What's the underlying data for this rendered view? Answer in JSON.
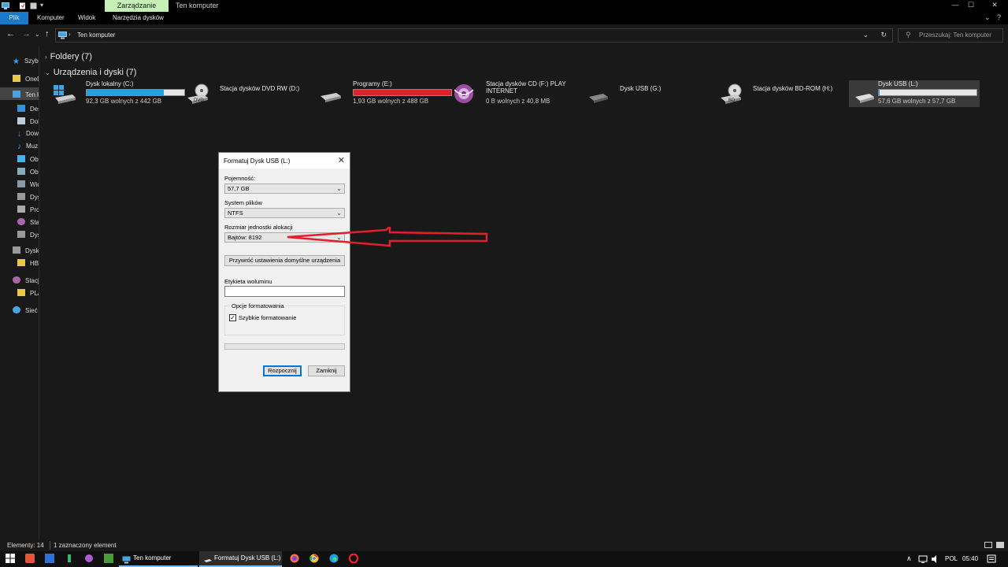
{
  "titlebar": {
    "context_tab": "Zarządzanie",
    "title": "Ten komputer",
    "min": "—",
    "max": "☐",
    "close": "✕"
  },
  "ribbon": {
    "tabs": [
      "Plik",
      "Komputer",
      "Widok",
      "Narzędzia dysków"
    ]
  },
  "address": {
    "path": "Ten komputer",
    "search_placeholder": "Przeszukaj: Ten komputer"
  },
  "nav": {
    "items": [
      "Szybk",
      "OneD",
      "Ten k",
      "Desk",
      "Doku",
      "Dow",
      "Muz",
      "Obie",
      "Obra",
      "Wide",
      "Dysk",
      "Prog",
      "Stac",
      "Dysk",
      "Dysk",
      "HBF",
      "Stacja",
      "PLA",
      "Sieć"
    ]
  },
  "content": {
    "group_folders": "Foldery (7)",
    "group_devices": "Urządzenia i dyski (7)",
    "drives": [
      {
        "name": "Dysk lokalny (C:)",
        "free": "92,3 GB wolnych z 442 GB",
        "used_fraction": 0.79,
        "bar_color": "#26a0da"
      },
      {
        "name": "Stacja dysków DVD RW (D:)",
        "free": "",
        "used_fraction": null,
        "bar_color": ""
      },
      {
        "name": "Programy (E:)",
        "free": "1,93 GB wolnych z 488 GB",
        "used_fraction": 0.996,
        "bar_color": "#da2626"
      },
      {
        "name": "Stacja dysków CD (F:) PLAY INTERNET",
        "free": "0 B wolnych z 40,8 MB",
        "used_fraction": null,
        "bar_color": ""
      },
      {
        "name": "Dysk USB (G:)",
        "free": "",
        "used_fraction": null,
        "bar_color": ""
      },
      {
        "name": "Stacja dysków BD-ROM (H:)",
        "free": "",
        "used_fraction": null,
        "bar_color": ""
      },
      {
        "name": "Dysk USB (L:)",
        "free": "57,6 GB wolnych z 57,7 GB",
        "used_fraction": 0.002,
        "bar_color": "#26a0da"
      }
    ]
  },
  "dialog": {
    "title": "Formatuj Dysk USB (L:)",
    "capacity_label": "Pojemność:",
    "capacity_value": "57,7 GB",
    "fs_label": "System plików",
    "fs_value": "NTFS",
    "alloc_label": "Rozmiar jednostki alokacji",
    "alloc_value": "Bajtów: 8192",
    "restore_button": "Przywróć ustawienia domyślne urządzenia",
    "volume_label": "Etykieta woluminu",
    "volume_value": "",
    "options_label": "Opcje formatowania",
    "quick_format_label": "Szybkie formatowanie",
    "quick_format_checked": "✓",
    "start_button": "Rozpocznij",
    "close_button": "Zamknij"
  },
  "status": {
    "count": "Elementy: 14",
    "selected": "1 zaznaczony element"
  },
  "taskbar": {
    "window1": "Ten komputer",
    "window2": "Formatuj Dysk USB (L:)",
    "lang": "POL",
    "time": "05:40",
    "tray_chevron": "∧"
  },
  "colors": {
    "accent": "#1979ca",
    "context_tab": "#c5f0b8",
    "arrow": "#e0202a"
  }
}
